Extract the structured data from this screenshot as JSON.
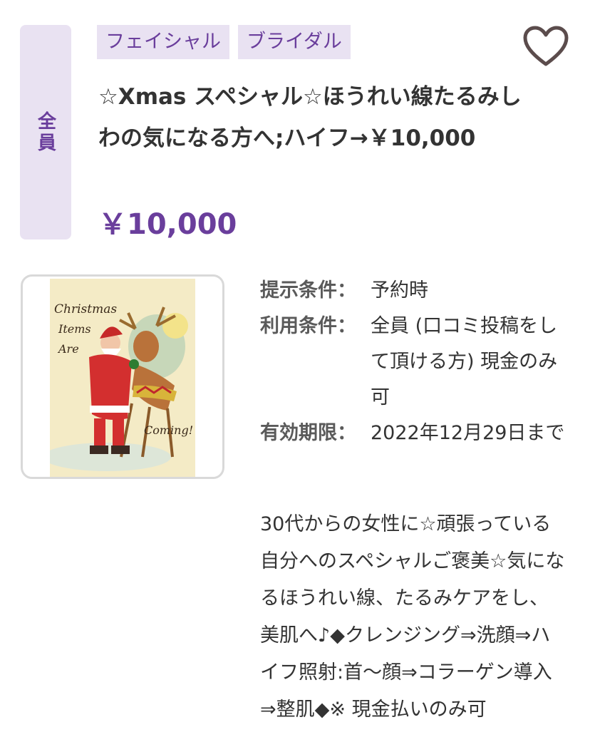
{
  "coupon": {
    "target": "全員",
    "tags": [
      "フェイシャル",
      "ブライダル"
    ],
    "title": "☆Xmas スペシャル☆ほうれい線たるみしわの気になる方へ;ハイフ→￥10,000",
    "price": "￥10,000",
    "image_text": {
      "line1": "Christmas",
      "line2": "Items",
      "line3": "Are",
      "line4": "Coming!"
    },
    "conditions": [
      {
        "label": "提示条件：",
        "value": "予約時"
      },
      {
        "label": "利用条件：",
        "value": "全員 (口コミ投稿をして頂ける方) 現金のみ可"
      },
      {
        "label": "有効期限：",
        "value": "2022年12月29日まで"
      }
    ],
    "description": "30代からの女性に☆頑張っている自分へのスペシャルご褒美☆気になるほうれい線、たるみケアをし、美肌へ♪◆クレンジング⇒洗顔⇒ハイフ照射:首〜顔⇒コラーゲン導入⇒整肌◆※ 現金払いのみ可"
  },
  "icons": {
    "favorite": "heart-outline-icon"
  },
  "colors": {
    "accent": "#6a3e9c",
    "badge_bg": "#e9e2f2",
    "text": "#333333"
  }
}
